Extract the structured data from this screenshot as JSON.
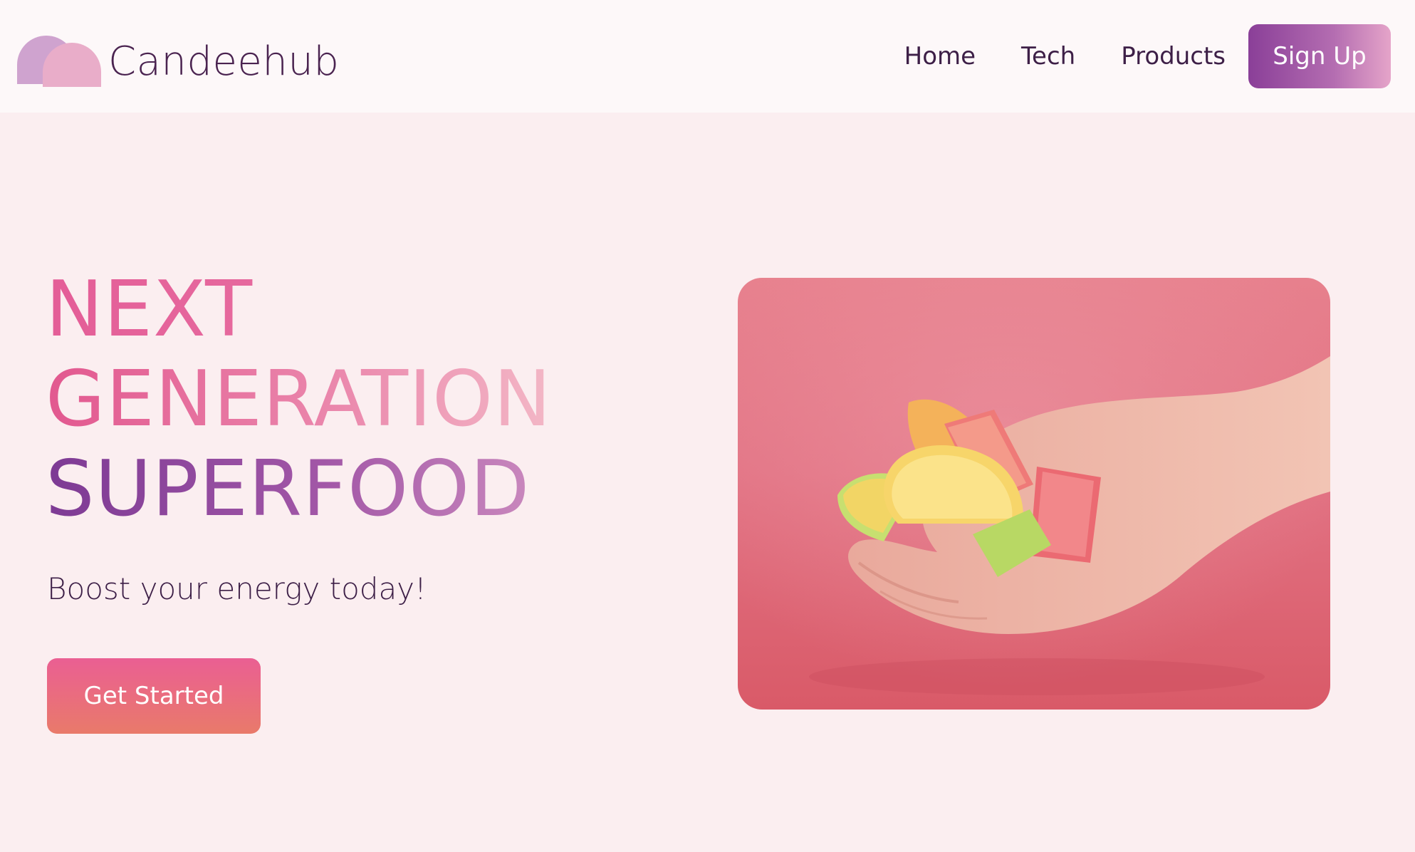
{
  "nav": {
    "brand": "Candeehub",
    "links": [
      {
        "label": "Home"
      },
      {
        "label": "Tech"
      },
      {
        "label": "Products"
      }
    ],
    "signup_label": "Sign Up"
  },
  "hero": {
    "headline": [
      "NEXT",
      "GENERATION",
      "SUPERFOOD"
    ],
    "tagline": "Boost your energy today!",
    "cta_label": "Get Started",
    "image_subject": "hand-holding-jelly-candies"
  },
  "colors": {
    "page_bg": "#fbeef0",
    "nav_bg": "#fdf8f9",
    "text_dark": "#3d1f47",
    "accent_pink": "#e45d97",
    "accent_purple": "#8a3f98",
    "cta_coral": "#e97a6a"
  },
  "icons": {
    "logo": "candeehub-logo-icon"
  }
}
